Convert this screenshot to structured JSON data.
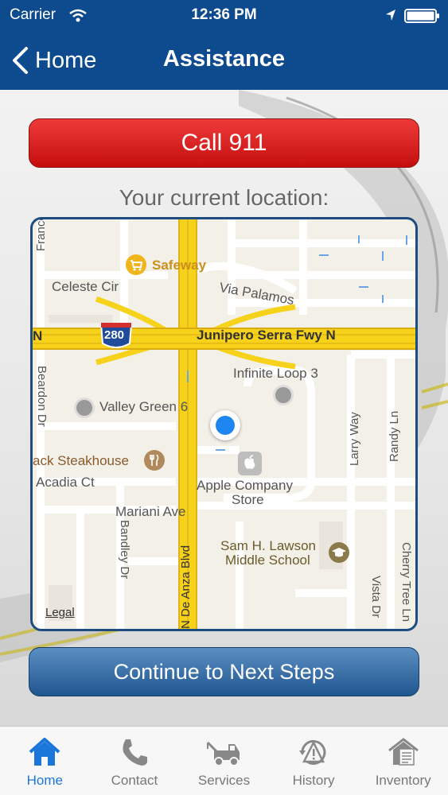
{
  "status_bar": {
    "carrier": "Carrier",
    "time": "12:36 PM"
  },
  "nav": {
    "back_label": "Home",
    "title": "Assistance"
  },
  "call_button": {
    "label": "Call 911"
  },
  "location_label": "Your current location:",
  "map": {
    "labels": {
      "franco": "Franco C",
      "safeway": "Safeway",
      "celeste": "Celeste Cir",
      "via_palamos": "Via Palamos",
      "shield": "280",
      "junipero": "Junipero Serra Fwy N",
      "n_left": "N",
      "infinite_loop": "Infinite Loop 3",
      "beardon": "Beardon Dr",
      "valley_green": "Valley Green 6",
      "larry_way": "Larry Way",
      "randy_ln": "Randy Ln",
      "steakhouse": "ack Steakhouse",
      "acadia": "Acadia Ct",
      "apple_store_1": "Apple Company",
      "apple_store_2": "Store",
      "mariani": "Mariani Ave",
      "bandley": "Bandley Dr",
      "de_anza": "N De Anza Blvd",
      "lawson_1": "Sam H. Lawson",
      "lawson_2": "Middle School",
      "vista": "Vista Dr",
      "cherry_tree": "Cherry Tree Ln",
      "legal": "Legal"
    }
  },
  "continue_button": {
    "label": "Continue to Next Steps"
  },
  "tabs": [
    {
      "label": "Home",
      "icon": "home-icon",
      "active": true
    },
    {
      "label": "Contact",
      "icon": "phone-icon",
      "active": false
    },
    {
      "label": "Services",
      "icon": "tow-truck-icon",
      "active": false
    },
    {
      "label": "History",
      "icon": "history-warning-icon",
      "active": false
    },
    {
      "label": "Inventory",
      "icon": "inventory-house-icon",
      "active": false
    }
  ],
  "colors": {
    "nav_bg": "#0d4a8e",
    "call_red": "#d91c1c",
    "continue_blue": "#2e6aa6",
    "tab_active": "#1a77d9",
    "highway": "#f7d21b"
  }
}
